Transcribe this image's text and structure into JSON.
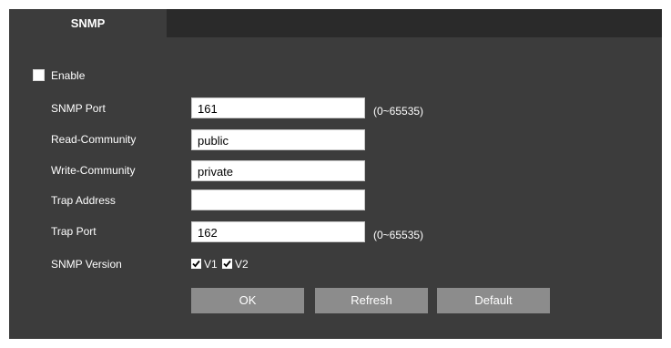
{
  "tabs": {
    "active_label": "SNMP"
  },
  "enable": {
    "label": "Enable",
    "checked": false
  },
  "form": {
    "snmp_port": {
      "label": "SNMP Port",
      "value": "161",
      "range": "(0~65535)"
    },
    "read_community": {
      "label": "Read-Community",
      "value": "public"
    },
    "write_community": {
      "label": "Write-Community",
      "value": "private"
    },
    "trap_address": {
      "label": "Trap Address",
      "value": ""
    },
    "trap_port": {
      "label": "Trap Port",
      "value": "162",
      "range": "(0~65535)"
    },
    "snmp_version": {
      "label": "SNMP Version",
      "v1_label": "V1",
      "v1_checked": true,
      "v2_label": "V2",
      "v2_checked": true
    }
  },
  "buttons": {
    "ok_label": "OK",
    "refresh_label": "Refresh",
    "default_label": "Default"
  },
  "colors": {
    "panel_bg": "#3c3c3c",
    "tabbar_bg": "#2a2a2a",
    "button_bg": "#8c8c8c",
    "text": "#ffffff"
  }
}
